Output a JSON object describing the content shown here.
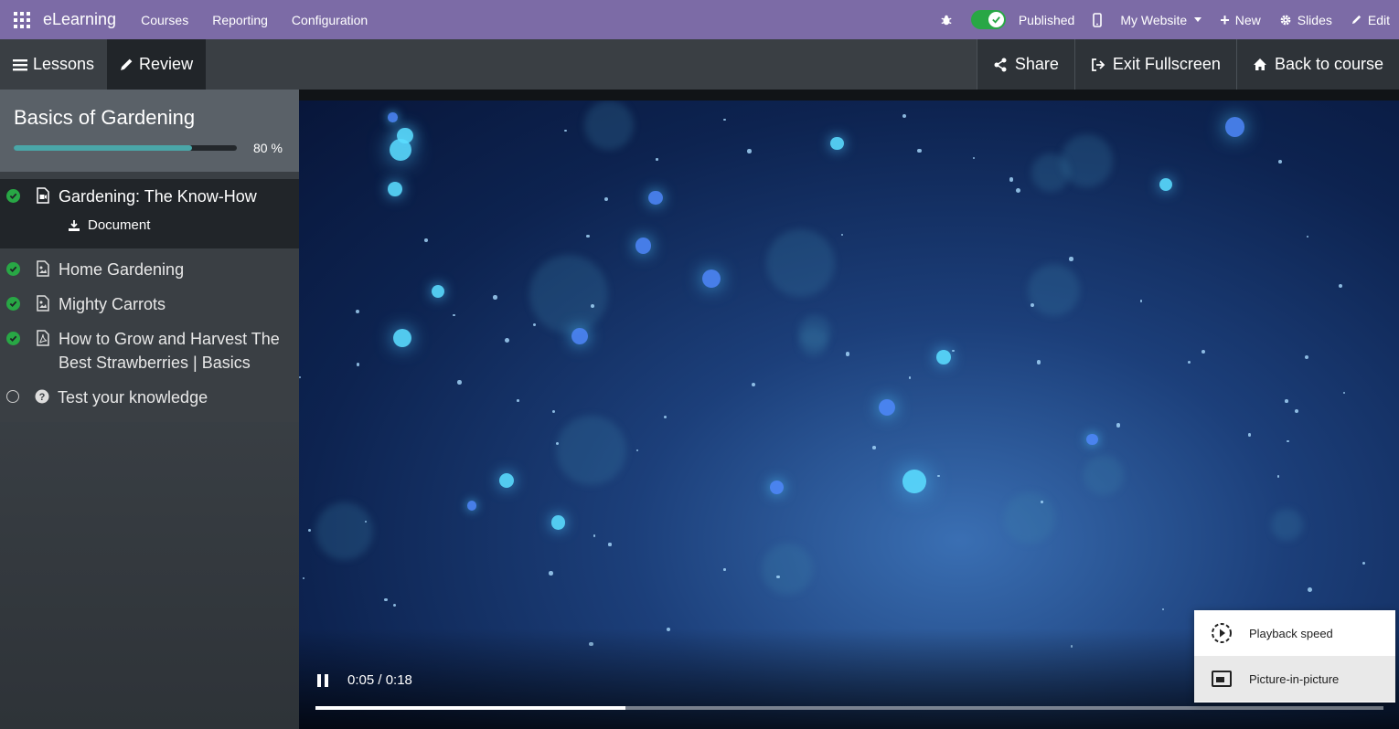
{
  "topbar": {
    "app_name": "eLearning",
    "menu": [
      "Courses",
      "Reporting",
      "Configuration"
    ],
    "published_label": "Published",
    "website_label": "My Website",
    "new_label": "New",
    "slides_label": "Slides",
    "edit_label": "Edit",
    "accent_color": "#7c6ba6"
  },
  "fullscreen_bar": {
    "lessons_tab": "Lessons",
    "review_tab": "Review",
    "share_label": "Share",
    "exit_label": "Exit Fullscreen",
    "back_label": "Back to course"
  },
  "course": {
    "title": "Basics of Gardening",
    "progress_text": "80 %",
    "progress_fraction": 0.8
  },
  "lessons": [
    {
      "title": "Gardening: The Know-How",
      "done": true,
      "icon": "document-video-icon",
      "active": true,
      "sub": "Document"
    },
    {
      "title": "Home Gardening",
      "done": true,
      "icon": "image-icon"
    },
    {
      "title": "Mighty Carrots",
      "done": true,
      "icon": "image-icon"
    },
    {
      "title": "How to Grow and Harvest The Best Strawberries | Basics",
      "done": true,
      "icon": "pdf-icon"
    },
    {
      "title": "Test your knowledge",
      "done": false,
      "icon": "question-icon"
    }
  ],
  "video": {
    "time_text": "0:05 / 0:18",
    "progress_fraction": 0.29
  },
  "video_menu": {
    "items": [
      "Playback speed",
      "Picture-in-picture"
    ]
  }
}
